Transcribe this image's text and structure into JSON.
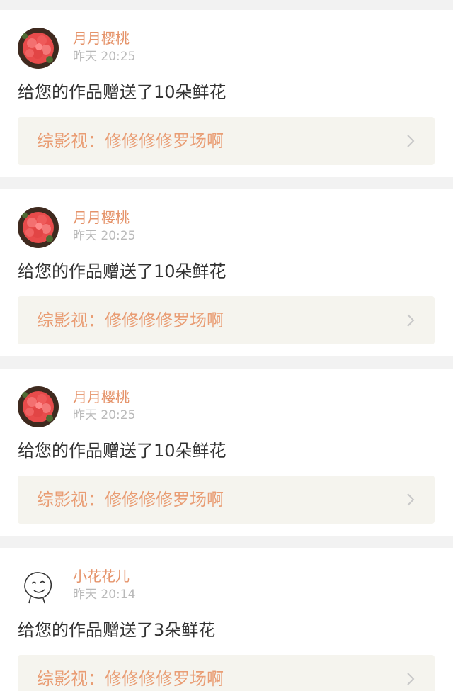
{
  "feed": {
    "cards": [
      {
        "user_name": "月月樱桃",
        "time": "昨天 20:25",
        "message": "给您的作品赠送了10朵鲜花",
        "work_title": "综影视：修修修修罗场啊",
        "avatar_icon": "red-flower-avatar"
      },
      {
        "user_name": "月月樱桃",
        "time": "昨天 20:25",
        "message": "给您的作品赠送了10朵鲜花",
        "work_title": "综影视：修修修修罗场啊",
        "avatar_icon": "red-flower-avatar"
      },
      {
        "user_name": "月月樱桃",
        "time": "昨天 20:25",
        "message": "给您的作品赠送了10朵鲜花",
        "work_title": "综影视：修修修修罗场啊",
        "avatar_icon": "red-flower-avatar"
      },
      {
        "user_name": "小花花儿",
        "time": "昨天 20:14",
        "message": "给您的作品赠送了3朵鲜花",
        "work_title": "综影视：修修修修罗场啊",
        "avatar_icon": "cartoon-face-avatar"
      }
    ]
  },
  "colors": {
    "name": "#e5936a",
    "time": "#b9b9b9",
    "message": "#333333",
    "work_title": "#e99d74",
    "work_link_bg": "#f5f4ee",
    "page_bg": "#f2f2f2"
  }
}
